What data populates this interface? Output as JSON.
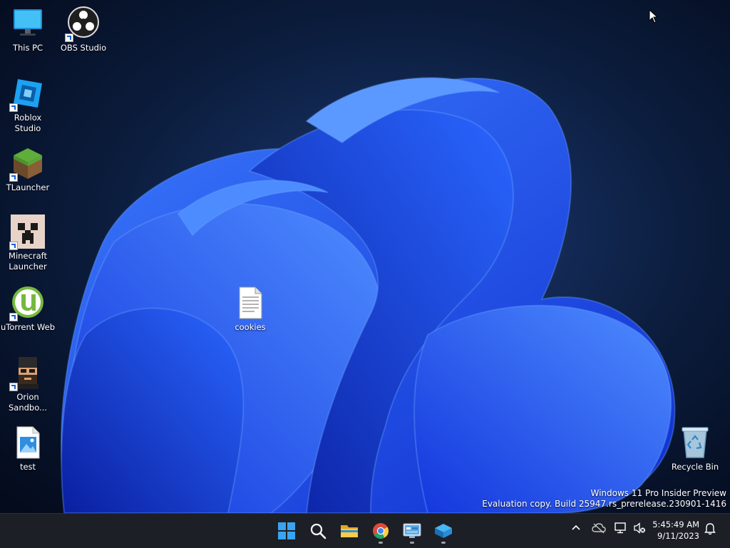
{
  "desktop": {
    "icons": [
      {
        "label": "This PC"
      },
      {
        "label": "OBS Studio"
      },
      {
        "label": "Roblox Studio"
      },
      {
        "label": "TLauncher"
      },
      {
        "label": "Minecraft Launcher"
      },
      {
        "label": "uTorrent Web"
      },
      {
        "label": "Orion Sandbo..."
      },
      {
        "label": "test"
      },
      {
        "label": "cookies"
      },
      {
        "label": "Recycle Bin"
      }
    ],
    "watermark": {
      "line1": "Windows 11 Pro Insider Preview",
      "line2": "Evaluation copy. Build 25947.rs_prerelease.230901-1416"
    }
  },
  "taskbar": {
    "apps": [
      {
        "icon": "windows-start-icon"
      },
      {
        "icon": "search-icon"
      },
      {
        "icon": "file-explorer-icon"
      },
      {
        "icon": "chrome-icon"
      },
      {
        "icon": "control-panel-icon"
      },
      {
        "icon": "app-cube-icon"
      }
    ],
    "clock": {
      "time": "5:45:49 AM",
      "date": "9/11/2023"
    }
  }
}
